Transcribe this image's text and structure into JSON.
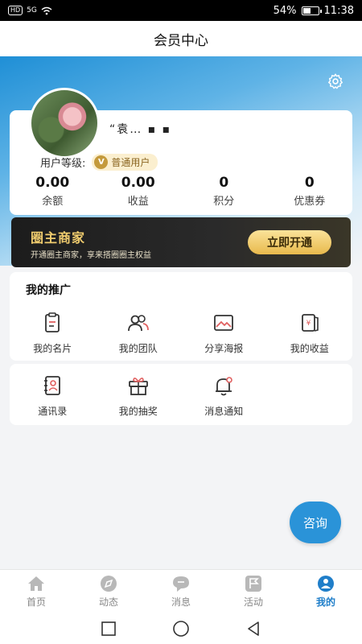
{
  "status_bar": {
    "hd": "HD",
    "signal": "5G",
    "battery_percent": "54%",
    "battery_level": 0.54,
    "time": "11:38"
  },
  "header": {
    "title": "会员中心"
  },
  "profile": {
    "username": "“袁… ▪ ▪",
    "level_label": "用户等级:",
    "level_value": "普通用户",
    "stats": [
      {
        "value": "0.00",
        "label": "余额"
      },
      {
        "value": "0.00",
        "label": "收益"
      },
      {
        "value": "0",
        "label": "积分"
      },
      {
        "value": "0",
        "label": "优惠券"
      }
    ]
  },
  "merchant_banner": {
    "title": "圈主商家",
    "subtitle": "开通圈主商家，享来搭圈圈主权益",
    "button": "立即开通"
  },
  "promotion": {
    "title": "我的推广",
    "items": [
      {
        "label": "我的名片",
        "icon": "clipboard-icon"
      },
      {
        "label": "我的团队",
        "icon": "team-icon"
      },
      {
        "label": "分享海报",
        "icon": "image-icon"
      },
      {
        "label": "我的收益",
        "icon": "income-icon"
      }
    ]
  },
  "tools": {
    "items": [
      {
        "label": "通讯录",
        "icon": "contacts-icon"
      },
      {
        "label": "我的抽奖",
        "icon": "gift-icon"
      },
      {
        "label": "消息通知",
        "icon": "bell-icon"
      }
    ]
  },
  "consult_button": "咨询",
  "bottom_nav": {
    "items": [
      {
        "label": "首页",
        "icon": "home-icon"
      },
      {
        "label": "动态",
        "icon": "compass-icon"
      },
      {
        "label": "消息",
        "icon": "chat-icon"
      },
      {
        "label": "活动",
        "icon": "flag-icon"
      },
      {
        "label": "我的",
        "icon": "user-icon",
        "active": true
      }
    ]
  },
  "colors": {
    "accent": "#1f7ec9",
    "gold": "#f0cc6e",
    "dark_banner": "#1c1c1c"
  }
}
